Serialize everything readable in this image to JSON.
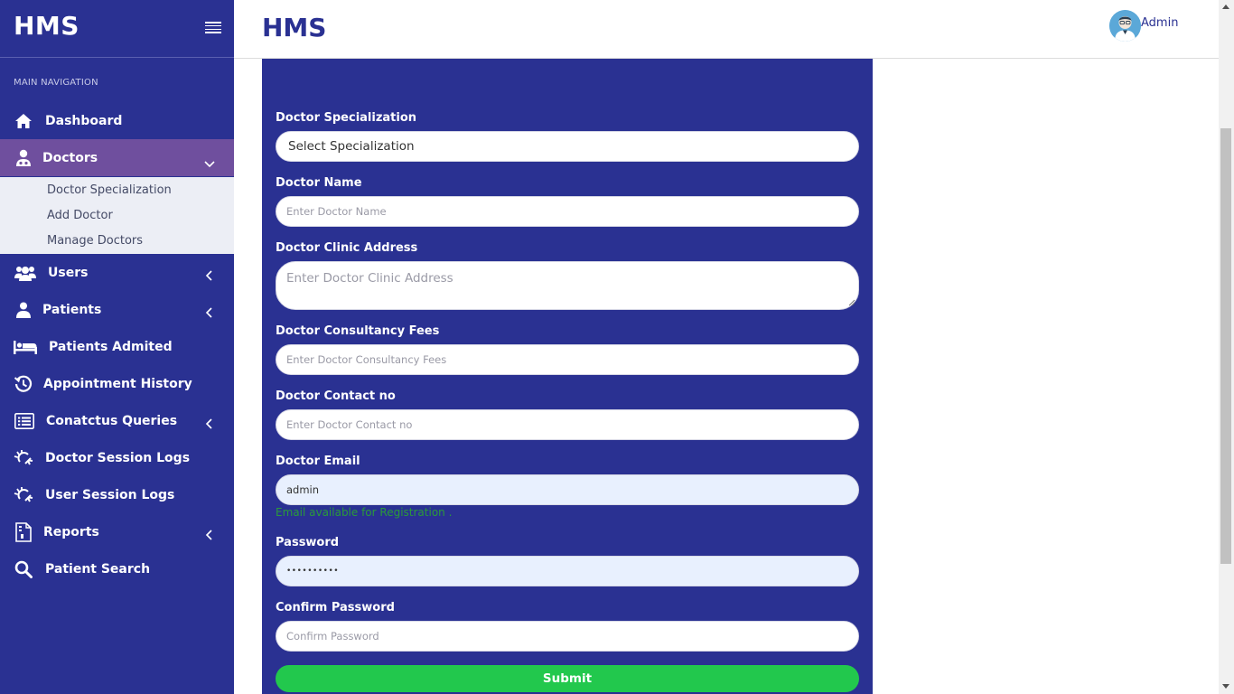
{
  "app": {
    "brand": "HMS",
    "page_title": "HMS"
  },
  "user": {
    "name": "Admin"
  },
  "sidebar": {
    "section_header": "MAIN NAVIGATION",
    "items": [
      {
        "label": "Dashboard",
        "icon": "home-icon"
      },
      {
        "label": "Doctors",
        "icon": "doctor-icon",
        "expanded": true
      },
      {
        "label": "Users",
        "icon": "users-icon"
      },
      {
        "label": "Patients",
        "icon": "patient-icon"
      },
      {
        "label": "Patients Admited",
        "icon": "bed-icon"
      },
      {
        "label": "Appointment History",
        "icon": "history-icon"
      },
      {
        "label": "Conatctus Queries",
        "icon": "list-icon"
      },
      {
        "label": "Doctor Session Logs",
        "icon": "session-log-icon"
      },
      {
        "label": "User Session Logs",
        "icon": "session-log-icon"
      },
      {
        "label": "Reports",
        "icon": "report-icon"
      },
      {
        "label": "Patient Search",
        "icon": "search-icon"
      }
    ],
    "doctors_submenu": [
      "Doctor Specialization",
      "Add Doctor",
      "Manage Doctors"
    ]
  },
  "form": {
    "specialization": {
      "label": "Doctor Specialization",
      "value": "Select Specialization"
    },
    "name": {
      "label": "Doctor Name",
      "placeholder": "Enter Doctor Name"
    },
    "address": {
      "label": "Doctor Clinic Address",
      "placeholder": "Enter Doctor Clinic Address"
    },
    "fees": {
      "label": "Doctor Consultancy Fees",
      "placeholder": "Enter Doctor Consultancy Fees"
    },
    "contact": {
      "label": "Doctor Contact no",
      "placeholder": "Enter Doctor Contact no"
    },
    "email": {
      "label": "Doctor Email",
      "value": "admin",
      "hint": "Email available for Registration ."
    },
    "password": {
      "label": "Password",
      "value": "••••••••••"
    },
    "confirm_password": {
      "label": "Confirm Password",
      "placeholder": "Confirm Password"
    },
    "submit_label": "Submit"
  },
  "colors": {
    "sidebar_bg": "#2a3192",
    "active_item": "#6f4f9e",
    "submit": "#22c84d",
    "hint": "#2a9a3a"
  }
}
